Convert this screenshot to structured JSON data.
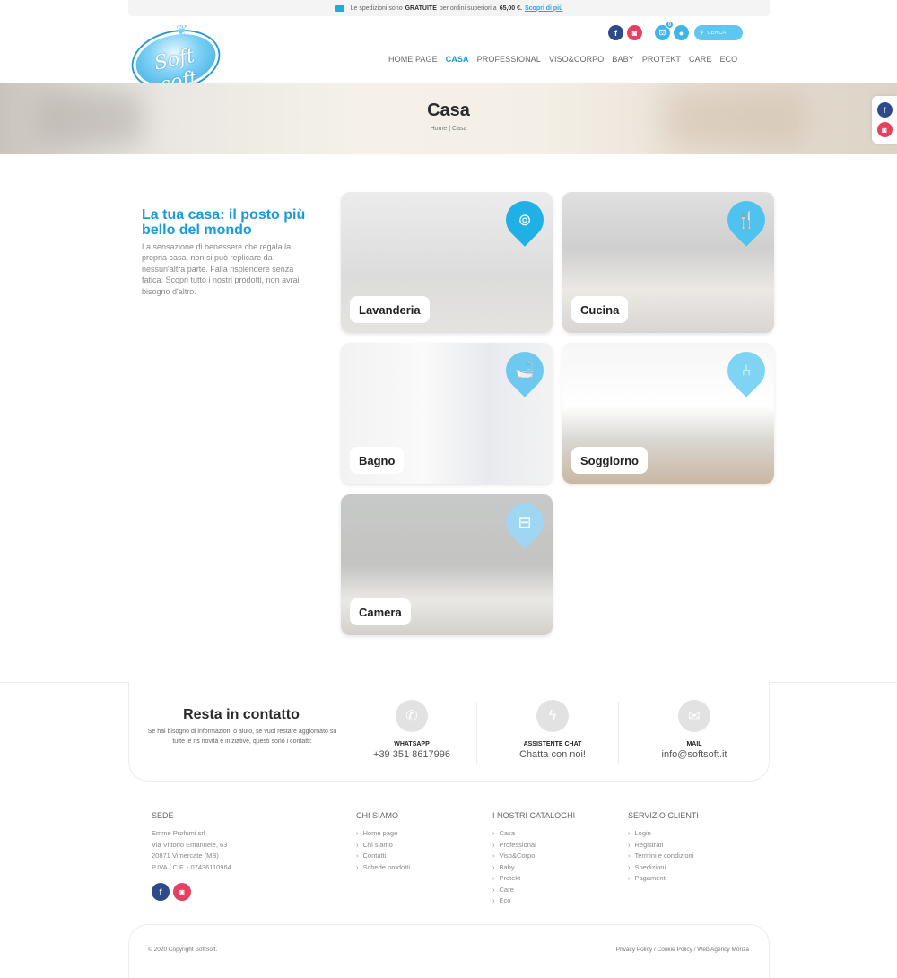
{
  "topbar": {
    "text_before": "Le spedizioni sono",
    "bold_word": "GRATUITE",
    "text_middle": "per ordini superiori a",
    "amount": "65,00 €.",
    "link": "Scopri di più"
  },
  "logo": {
    "text": "Soft soft"
  },
  "header": {
    "cart_count": "0",
    "search_placeholder": "CERCA"
  },
  "nav": [
    {
      "label": "HOME PAGE",
      "active": false
    },
    {
      "label": "CASA",
      "active": true
    },
    {
      "label": "PROFESSIONAL",
      "active": false
    },
    {
      "label": "VISO&CORPO",
      "active": false
    },
    {
      "label": "BABY",
      "active": false
    },
    {
      "label": "PROTEKT",
      "active": false
    },
    {
      "label": "CARE",
      "active": false
    },
    {
      "label": "ECO",
      "active": false
    }
  ],
  "hero": {
    "title": "Casa",
    "breadcrumb": {
      "home": "Home",
      "separator": "|",
      "current": "Casa"
    }
  },
  "intro": {
    "title": "La tua casa: il posto più bello del mondo",
    "text": "La sensazione di benessere che regala la propria casa, non si può replicare da nessun'altra parte. Falla risplendere senza fatica. Scopri tutto i nostri prodotti, non avrai bisogno d'altro."
  },
  "categories": [
    {
      "label": "Lavanderia",
      "icon": "washing-machine-icon",
      "pin_color": "#1fb0e6"
    },
    {
      "label": "Cucina",
      "icon": "cutlery-icon",
      "pin_color": "#4fc3ef"
    },
    {
      "label": "Bagno",
      "icon": "bathtub-icon",
      "pin_color": "#6ec9f0"
    },
    {
      "label": "Soggiorno",
      "icon": "armchair-icon",
      "pin_color": "#7fd4f4"
    },
    {
      "label": "Camera",
      "icon": "bed-icon",
      "pin_color": "#9fd6f2"
    }
  ],
  "contact": {
    "title": "Resta in contatto",
    "text": "Se hai bisogno di informazioni o aiuto, se vuoi restare aggiornato su tutte le ns novità e iniziative, questi sono i contatti:",
    "items": [
      {
        "title": "WHATSAPP",
        "value": "+39 351 8617996",
        "icon": "phone-icon"
      },
      {
        "title": "ASSISTENTE CHAT",
        "value": "Chatta con noi!",
        "icon": "messenger-icon"
      },
      {
        "title": "MAIL",
        "value": "info@softsoft.it",
        "icon": "mail-icon"
      }
    ]
  },
  "footer": {
    "sede": {
      "title": "SEDE",
      "lines": [
        "Emme Profumi srl",
        "Via Vittorio Emanuele, 63",
        "20871 Vimercate (MB)",
        "P.IVA / C.F. - 07436110964"
      ]
    },
    "chi_siamo": {
      "title": "CHI SIAMO",
      "links": [
        "Home page",
        "Chi siamo",
        "Contatti",
        "Schede prodotti"
      ]
    },
    "cataloghi": {
      "title": "I NOSTRI CATALOGHI",
      "links": [
        "Casa",
        "Professional",
        "Viso&Corpo",
        "Baby",
        "Protekt",
        "Care",
        "Eco"
      ]
    },
    "servizio": {
      "title": "SERVIZIO CLIENTI",
      "links": [
        "Login",
        "Registrati",
        "Termini e condizioni",
        "Spedizioni",
        "Pagamenti"
      ]
    },
    "copyright": "© 2020 Copyright SoftSoft.",
    "legal_links": "Privacy Policy / Cookie Policy / Web Agency Monza"
  },
  "colors": {
    "accent": "#1a9bd7",
    "facebook": "#2d4a8a",
    "instagram": "#e4405f"
  }
}
